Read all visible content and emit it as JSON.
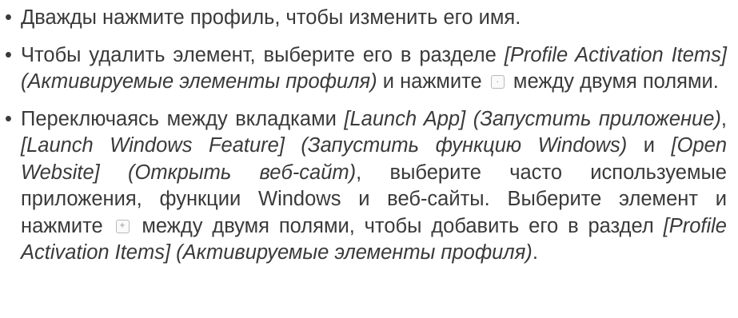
{
  "items": [
    {
      "text": "Дважды нажмите профиль, чтобы изменить его имя."
    },
    {
      "p1": "Чтобы удалить элемент, выберите его в разделе ",
      "e1": "[Profile Activation Items] (Активируемые элементы профиля)",
      "p2": " и нажмите ",
      "p3": " между двумя полями."
    },
    {
      "p1": "Переключаясь между вкладками ",
      "e1": "[Launch App] (Запустить приложение)",
      "p2": ", ",
      "e2": "[Launch Windows Feature] (Запустить функцию Windows)",
      "p3": " и ",
      "e3": "[Open Website] (Открыть веб-сайт)",
      "p4": ", выберите часто используемые приложения, функции Windows и веб-сайты. Выберите элемент и нажмите ",
      "p5": " между двумя полями, чтобы добавить его в раздел ",
      "e4": "[Profile Activation Items] (Активируемые элементы профиля)",
      "p6": "."
    }
  ],
  "icons": {
    "remove": {
      "name": "remove-icon",
      "glyph": "·"
    },
    "add": {
      "name": "add-icon",
      "glyph": "+"
    }
  }
}
